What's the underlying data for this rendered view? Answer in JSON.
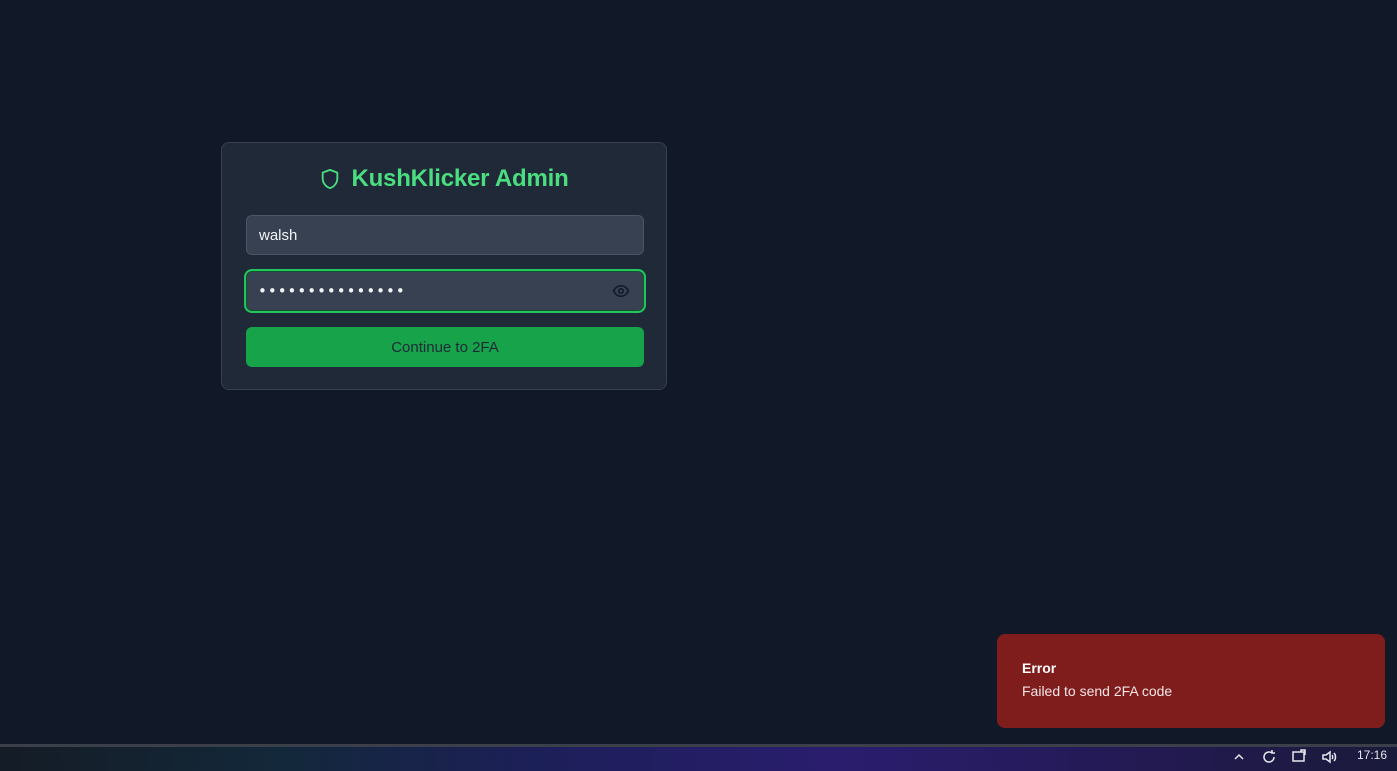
{
  "app": {
    "title": "KushKlicker Admin"
  },
  "login": {
    "username_value": "walsh",
    "password_mask": "•••••••••••••••",
    "submit_label": "Continue to 2FA"
  },
  "toast": {
    "title": "Error",
    "message": "Failed to send 2FA code"
  },
  "taskbar": {
    "clock": "17:16"
  },
  "icons": {
    "title_icon": "shield-icon",
    "password_toggle": "eye-icon"
  },
  "colors": {
    "background": "#111827",
    "card": "#1f2937",
    "accent": "#4ade80",
    "button": "#16a34a",
    "error": "#7f1d1d"
  }
}
